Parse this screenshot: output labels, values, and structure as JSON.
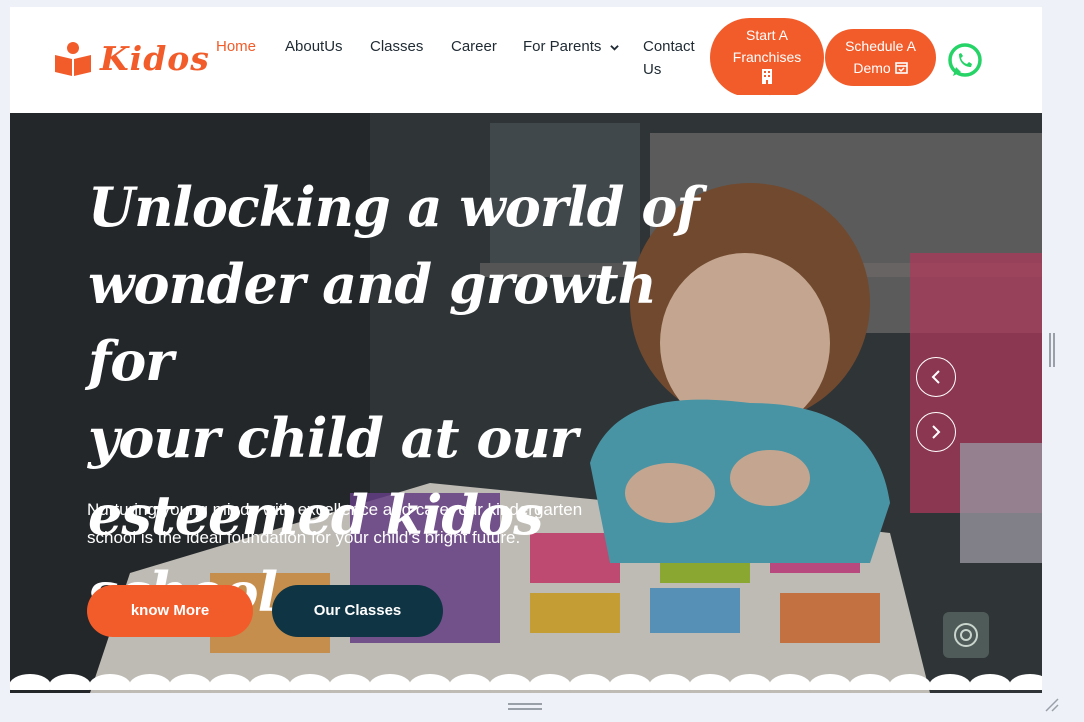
{
  "brand": {
    "name": "Kidos",
    "accent": "#f25c2a",
    "dark": "#0f3443",
    "whatsapp": "#25d366"
  },
  "nav": {
    "home": "Home",
    "about": "AboutUs",
    "classes": "Classes",
    "career": "Career",
    "parents": "For Parents",
    "contact_1": "Contact",
    "contact_2": "Us"
  },
  "header_buttons": {
    "franchise_1": "Start A",
    "franchise_2": "Franchises",
    "demo_1": "Schedule A",
    "demo_2": "Demo"
  },
  "hero": {
    "headline": [
      "Unlocking a world of",
      "wonder and growth for",
      "your child at our",
      "esteemed kidos school."
    ],
    "subtext_1": "Nurturing young minds with excellence and care, our kindergarten",
    "subtext_2": "school is the ideal foundation for your child's bright future.",
    "btn_know": "know More",
    "btn_classes": "Our Classes"
  },
  "icons": {
    "logo": "book-reader-icon",
    "dropdown": "chevron-down-icon",
    "building": "building-icon",
    "calendar": "calendar-check-icon",
    "whatsapp": "whatsapp-icon",
    "prev": "chevron-left-icon",
    "next": "chevron-right-icon",
    "chat": "chat-widget-icon"
  }
}
